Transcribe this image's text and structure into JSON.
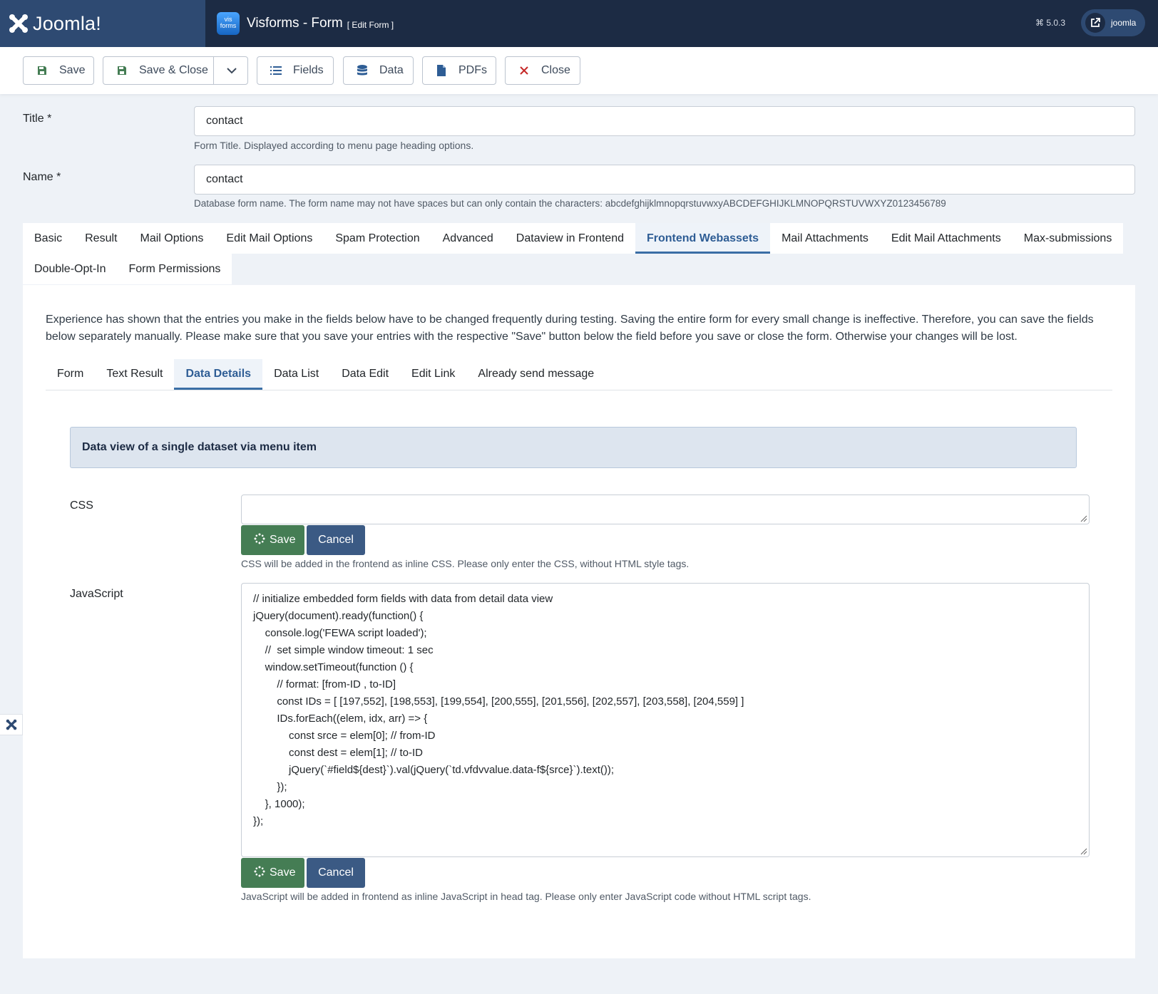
{
  "header": {
    "brand": "Joomla!",
    "app_logo_text": "vis forms",
    "title": "Visforms - Form",
    "subtitle": "[ Edit Form ]",
    "version": "5.0.3",
    "user": "joomla"
  },
  "toolbar": {
    "save": "Save",
    "save_close": "Save & Close",
    "fields": "Fields",
    "data": "Data",
    "pdfs": "PDFs",
    "close": "Close"
  },
  "form": {
    "title_label": "Title *",
    "title_value": "contact",
    "title_hint": "Form Title. Displayed according to menu page heading options.",
    "name_label": "Name *",
    "name_value": "contact",
    "name_hint": "Database form name. The form name may not have spaces but can only contain the characters: abcdefghijklmnopqrstuvwxyABCDEFGHIJKLMNOPQRSTUVWXYZ0123456789"
  },
  "outer_tabs": {
    "row1": [
      "Basic",
      "Result",
      "Mail Options",
      "Edit Mail Options",
      "Spam Protection",
      "Advanced",
      "Dataview in Frontend",
      "Frontend Webassets",
      "Mail Attachments",
      "Edit Mail Attachments",
      "Max-submissions"
    ],
    "row2": [
      "Double-Opt-In",
      "Form Permissions"
    ],
    "active": "Frontend Webassets"
  },
  "panel": {
    "intro": "Experience has shown that the entries you make in the fields below have to be changed frequently during testing. Saving the entire form for every small change is ineffective. Therefore, you can save the fields below separately manually. Please make sure that you save your entries with the respective \"Save\" button below the field before you save or close the form. Otherwise your changes will be lost.",
    "inner_tabs": [
      "Form",
      "Text Result",
      "Data Details",
      "Data List",
      "Data Edit",
      "Edit Link",
      "Already send message"
    ],
    "inner_active": "Data Details",
    "info": "Data view of a single dataset via menu item",
    "css_label": "CSS",
    "css_value": "",
    "css_hint": "CSS will be added in the frontend as inline CSS. Please only enter the CSS, without HTML style tags.",
    "js_label": "JavaScript",
    "js_code": "// initialize embedded form fields with data from detail data view\njQuery(document).ready(function() {\n    console.log('FEWA script loaded');\n    //  set simple window timeout: 1 sec\n    window.setTimeout(function () {\n        // format: [from-ID , to-ID]\n        const IDs = [ [197,552], [198,553], [199,554], [200,555], [201,556], [202,557], [203,558], [204,559] ]\n        IDs.forEach((elem, idx, arr) => {\n            const srce = elem[0]; // from-ID\n            const dest = elem[1]; // to-ID\n            jQuery(`#field${dest}`).val(jQuery(`td.vfdvvalue.data-f${srce}`).text());\n        });\n    }, 1000);\n});",
    "js_hint": "JavaScript will be added in frontend as inline JavaScript in head tag. Please only enter JavaScript code without HTML script tags.",
    "save_label": "Save",
    "cancel_label": "Cancel"
  }
}
